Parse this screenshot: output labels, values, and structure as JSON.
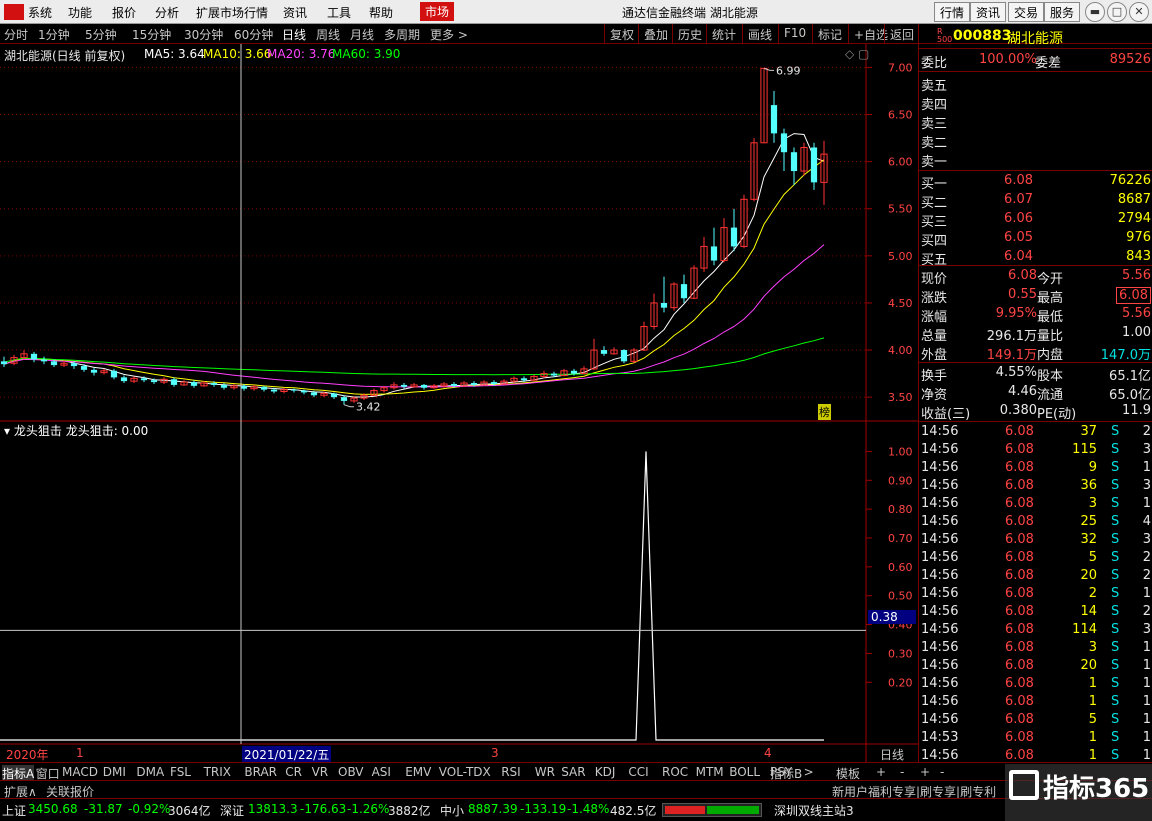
{
  "menubar": {
    "items": [
      "系统",
      "功能",
      "报价",
      "分析",
      "扩展市场行情",
      "资讯",
      "工具",
      "帮助"
    ],
    "market": "市场",
    "title": "通达信金融终端  湖北能源",
    "right_buttons": [
      "行情",
      "资讯",
      "交易",
      "服务"
    ]
  },
  "periodbar": {
    "periods": [
      "分时",
      "1分钟",
      "5分钟",
      "15分钟",
      "30分钟",
      "60分钟",
      "日线",
      "周线",
      "月线",
      "多周期",
      "更多 >"
    ],
    "selected": "日线",
    "tools": [
      "复权",
      "叠加",
      "历史",
      "统计",
      "画线",
      "F10",
      "标记",
      "+自选",
      "返回"
    ]
  },
  "chart_data": [
    {
      "type": "candlestick",
      "title": "湖北能源(日线 前复权)",
      "ma_legend": [
        {
          "label": "MA5: 3.64",
          "color": "#ffffff"
        },
        {
          "label": "MA10: 3.66",
          "color": "#ffff00"
        },
        {
          "label": "MA20: 3.76",
          "color": "#ff40ff"
        },
        {
          "label": "MA60: 3.90",
          "color": "#00ff00"
        }
      ],
      "y_ticks": [
        "7.00",
        "6.50",
        "6.00",
        "5.50",
        "5.00",
        "4.50",
        "4.00",
        "3.50"
      ],
      "ylim": [
        3.3,
        7.1
      ],
      "annotations": [
        {
          "text": "6.99",
          "value": 6.99
        },
        {
          "text": "3.42",
          "value": 3.42
        }
      ],
      "marker_label": "榜",
      "candles": [
        [
          3.88,
          3.85,
          3.93,
          3.82
        ],
        [
          3.86,
          3.92,
          3.95,
          3.84
        ],
        [
          3.92,
          3.96,
          4.0,
          3.9
        ],
        [
          3.96,
          3.9,
          3.98,
          3.87
        ],
        [
          3.9,
          3.88,
          3.93,
          3.85
        ],
        [
          3.88,
          3.84,
          3.9,
          3.82
        ],
        [
          3.84,
          3.86,
          3.89,
          3.82
        ],
        [
          3.86,
          3.83,
          3.88,
          3.8
        ],
        [
          3.83,
          3.79,
          3.85,
          3.77
        ],
        [
          3.79,
          3.76,
          3.81,
          3.73
        ],
        [
          3.76,
          3.78,
          3.8,
          3.74
        ],
        [
          3.78,
          3.71,
          3.8,
          3.69
        ],
        [
          3.71,
          3.67,
          3.73,
          3.65
        ],
        [
          3.67,
          3.7,
          3.72,
          3.65
        ],
        [
          3.7,
          3.68,
          3.72,
          3.66
        ],
        [
          3.68,
          3.66,
          3.7,
          3.64
        ],
        [
          3.66,
          3.69,
          3.71,
          3.64
        ],
        [
          3.69,
          3.63,
          3.71,
          3.61
        ],
        [
          3.63,
          3.66,
          3.68,
          3.62
        ],
        [
          3.66,
          3.62,
          3.68,
          3.6
        ],
        [
          3.62,
          3.65,
          3.67,
          3.61
        ],
        [
          3.65,
          3.63,
          3.67,
          3.61
        ],
        [
          3.63,
          3.6,
          3.65,
          3.58
        ],
        [
          3.6,
          3.62,
          3.64,
          3.58
        ],
        [
          3.62,
          3.59,
          3.64,
          3.57
        ],
        [
          3.59,
          3.61,
          3.63,
          3.57
        ],
        [
          3.61,
          3.58,
          3.62,
          3.56
        ],
        [
          3.58,
          3.56,
          3.6,
          3.54
        ],
        [
          3.56,
          3.58,
          3.6,
          3.54
        ],
        [
          3.58,
          3.57,
          3.59,
          3.55
        ],
        [
          3.57,
          3.55,
          3.58,
          3.53
        ],
        [
          3.55,
          3.52,
          3.57,
          3.5
        ],
        [
          3.52,
          3.54,
          3.56,
          3.5
        ],
        [
          3.54,
          3.5,
          3.55,
          3.48
        ],
        [
          3.5,
          3.46,
          3.52,
          3.42
        ],
        [
          3.46,
          3.49,
          3.51,
          3.44
        ],
        [
          3.49,
          3.52,
          3.54,
          3.47
        ],
        [
          3.52,
          3.57,
          3.59,
          3.51
        ],
        [
          3.57,
          3.6,
          3.62,
          3.55
        ],
        [
          3.6,
          3.63,
          3.66,
          3.58
        ],
        [
          3.63,
          3.61,
          3.65,
          3.59
        ],
        [
          3.61,
          3.63,
          3.65,
          3.6
        ],
        [
          3.63,
          3.6,
          3.64,
          3.58
        ],
        [
          3.6,
          3.62,
          3.64,
          3.59
        ],
        [
          3.62,
          3.64,
          3.66,
          3.6
        ],
        [
          3.64,
          3.62,
          3.66,
          3.6
        ],
        [
          3.62,
          3.65,
          3.67,
          3.61
        ],
        [
          3.65,
          3.63,
          3.67,
          3.61
        ],
        [
          3.63,
          3.66,
          3.68,
          3.62
        ],
        [
          3.66,
          3.64,
          3.68,
          3.62
        ],
        [
          3.64,
          3.67,
          3.69,
          3.63
        ],
        [
          3.67,
          3.7,
          3.72,
          3.65
        ],
        [
          3.7,
          3.68,
          3.72,
          3.66
        ],
        [
          3.68,
          3.72,
          3.74,
          3.67
        ],
        [
          3.72,
          3.75,
          3.78,
          3.7
        ],
        [
          3.75,
          3.73,
          3.77,
          3.71
        ],
        [
          3.73,
          3.78,
          3.8,
          3.72
        ],
        [
          3.78,
          3.75,
          3.8,
          3.73
        ],
        [
          3.75,
          3.8,
          3.83,
          3.74
        ],
        [
          3.8,
          4.0,
          4.12,
          3.79
        ],
        [
          4.0,
          3.96,
          4.04,
          3.94
        ],
        [
          3.96,
          4.0,
          4.03,
          3.95
        ],
        [
          4.0,
          3.88,
          4.01,
          3.86
        ],
        [
          3.88,
          4.0,
          4.02,
          3.86
        ],
        [
          4.0,
          4.25,
          4.3,
          3.99
        ],
        [
          4.25,
          4.5,
          4.6,
          4.22
        ],
        [
          4.5,
          4.45,
          4.78,
          4.4
        ],
        [
          4.45,
          4.7,
          4.72,
          4.42
        ],
        [
          4.7,
          4.55,
          4.8,
          4.5
        ],
        [
          4.55,
          4.87,
          4.9,
          4.54
        ],
        [
          4.87,
          5.1,
          5.2,
          4.83
        ],
        [
          5.1,
          4.95,
          5.3,
          4.9
        ],
        [
          4.95,
          5.3,
          5.4,
          4.93
        ],
        [
          5.3,
          5.1,
          5.5,
          5.05
        ],
        [
          5.1,
          5.6,
          5.65,
          5.08
        ],
        [
          5.6,
          6.2,
          6.25,
          5.58
        ],
        [
          6.2,
          6.99,
          6.99,
          6.2
        ],
        [
          6.6,
          6.3,
          6.75,
          6.2
        ],
        [
          6.3,
          6.1,
          6.35,
          5.9
        ],
        [
          6.1,
          5.9,
          6.15,
          5.75
        ],
        [
          5.9,
          6.15,
          6.2,
          5.85
        ],
        [
          6.15,
          5.78,
          6.2,
          5.7
        ],
        [
          5.78,
          6.08,
          6.22,
          5.54
        ]
      ]
    },
    {
      "type": "line",
      "title": "龙头狙击",
      "legend": "龙头狙击: 0.00",
      "y_ticks": [
        "1.00",
        "0.90",
        "0.80",
        "0.70",
        "0.60",
        "0.50",
        "0.40",
        "0.30",
        "0.20"
      ],
      "ylim": [
        0,
        1.05
      ],
      "crosshair_value": "0.38",
      "spike_value": 1.0
    }
  ],
  "xaxis": {
    "labels": [
      "2020年",
      "1",
      "3",
      "4"
    ],
    "crosshair_date": "2021/01/22/五",
    "period": "日线"
  },
  "quote": {
    "code": "000883",
    "name": "湖北能源",
    "badge_top": "R",
    "badge_bottom": "500",
    "weibi_label": "委比",
    "weibi": "100.00%",
    "weicha_label": "委差",
    "weicha": "89526",
    "sells": [
      {
        "label": "卖五"
      },
      {
        "label": "卖四"
      },
      {
        "label": "卖三"
      },
      {
        "label": "卖二"
      },
      {
        "label": "卖一"
      }
    ],
    "buys": [
      {
        "label": "买一",
        "price": "6.08",
        "vol": "76226"
      },
      {
        "label": "买二",
        "price": "6.07",
        "vol": "8687"
      },
      {
        "label": "买三",
        "price": "6.06",
        "vol": "2794"
      },
      {
        "label": "买四",
        "price": "6.05",
        "vol": "976"
      },
      {
        "label": "买五",
        "price": "6.04",
        "vol": "843"
      }
    ],
    "stats": [
      {
        "l1": "现价",
        "v1": "6.08",
        "l2": "今开",
        "v2": "5.56"
      },
      {
        "l1": "涨跌",
        "v1": "0.55",
        "l2": "最高",
        "v2": "6.08"
      },
      {
        "l1": "涨幅",
        "v1": "9.95%",
        "l2": "最低",
        "v2": "5.56"
      },
      {
        "l1": "总量",
        "v1": "296.1万",
        "l2": "量比",
        "v2": "1.00"
      },
      {
        "l1": "外盘",
        "v1": "149.1万",
        "l2": "内盘",
        "v2": "147.0万"
      }
    ],
    "stats2": [
      {
        "l1": "换手",
        "v1": "4.55%",
        "l2": "股本",
        "v2": "65.1亿"
      },
      {
        "l1": "净资",
        "v1": "4.46",
        "l2": "流通",
        "v2": "65.0亿"
      },
      {
        "l1": "收益(三)",
        "v1": "0.380",
        "l2": "PE(动)",
        "v2": "11.9"
      }
    ],
    "ticks": [
      {
        "t": "14:56",
        "p": "6.08",
        "v": "37",
        "d": "S",
        "n": "2"
      },
      {
        "t": "14:56",
        "p": "6.08",
        "v": "115",
        "d": "S",
        "n": "3"
      },
      {
        "t": "14:56",
        "p": "6.08",
        "v": "9",
        "d": "S",
        "n": "1"
      },
      {
        "t": "14:56",
        "p": "6.08",
        "v": "36",
        "d": "S",
        "n": "3"
      },
      {
        "t": "14:56",
        "p": "6.08",
        "v": "3",
        "d": "S",
        "n": "1"
      },
      {
        "t": "14:56",
        "p": "6.08",
        "v": "25",
        "d": "S",
        "n": "4"
      },
      {
        "t": "14:56",
        "p": "6.08",
        "v": "32",
        "d": "S",
        "n": "3"
      },
      {
        "t": "14:56",
        "p": "6.08",
        "v": "5",
        "d": "S",
        "n": "2"
      },
      {
        "t": "14:56",
        "p": "6.08",
        "v": "20",
        "d": "S",
        "n": "2"
      },
      {
        "t": "14:56",
        "p": "6.08",
        "v": "2",
        "d": "S",
        "n": "1"
      },
      {
        "t": "14:56",
        "p": "6.08",
        "v": "14",
        "d": "S",
        "n": "2"
      },
      {
        "t": "14:56",
        "p": "6.08",
        "v": "114",
        "d": "S",
        "n": "3"
      },
      {
        "t": "14:56",
        "p": "6.08",
        "v": "3",
        "d": "S",
        "n": "1"
      },
      {
        "t": "14:56",
        "p": "6.08",
        "v": "20",
        "d": "S",
        "n": "1"
      },
      {
        "t": "14:56",
        "p": "6.08",
        "v": "1",
        "d": "S",
        "n": "1"
      },
      {
        "t": "14:56",
        "p": "6.08",
        "v": "1",
        "d": "S",
        "n": "1"
      },
      {
        "t": "14:56",
        "p": "6.08",
        "v": "5",
        "d": "S",
        "n": "1"
      },
      {
        "t": "14:53",
        "p": "6.08",
        "v": "1",
        "d": "S",
        "n": "1"
      },
      {
        "t": "14:56",
        "p": "6.08",
        "v": "1",
        "d": "S",
        "n": "1"
      }
    ]
  },
  "tabs": {
    "items": [
      "指标A",
      "窗口",
      "MACD",
      "DMI",
      "DMA",
      "FSL",
      "TRIX",
      "BRAR",
      "CR",
      "VR",
      "OBV",
      "ASI",
      "EMV",
      "VOL-TDX",
      "RSI",
      "WR",
      "SAR",
      "KDJ",
      "CCI",
      "ROC",
      "MTM",
      "BOLL",
      "PSY",
      ">"
    ],
    "right": [
      "指标B",
      "模板",
      "+",
      "-",
      "+",
      "-"
    ]
  },
  "status2": {
    "items": [
      "扩展∧",
      "关联报价"
    ],
    "ticker": "新用户福利专享|刷专享|刷专利"
  },
  "indexbar": {
    "sh_label": "上证",
    "sh_val": "3450.68",
    "sh_chg": "-31.87",
    "sh_pct": "-0.92%",
    "sh_amt": "3064亿",
    "sz_label": "深证",
    "sz_val": "13813.3",
    "sz_chg": "-176.63",
    "sz_pct": "-1.26%",
    "sz_amt": "3882亿",
    "zx_label": "中小",
    "zx_val": "8887.39",
    "zx_chg": "-133.19",
    "zx_pct": "-1.48%",
    "zx_amt": "482.5亿",
    "server": "深圳双线主站3"
  },
  "logo": {
    "text": "指标365"
  }
}
